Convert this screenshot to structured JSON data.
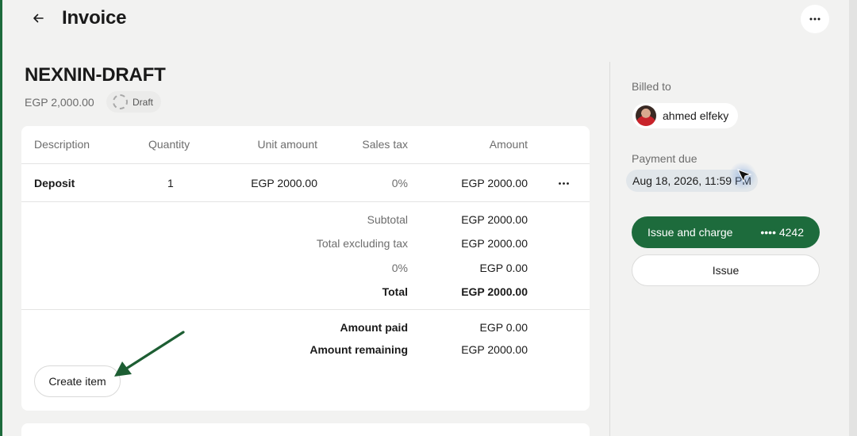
{
  "header": {
    "title": "Invoice",
    "back_icon": "arrow-left-icon",
    "more_icon": "ellipsis-icon"
  },
  "invoice": {
    "number": "NEXNIN-DRAFT",
    "amount": "EGP 2,000.00",
    "status": "Draft"
  },
  "table": {
    "columns": [
      "Description",
      "Quantity",
      "Unit amount",
      "Sales tax",
      "Amount"
    ],
    "rows": [
      {
        "description": "Deposit",
        "quantity": "1",
        "unit_amount": "EGP 2000.00",
        "sales_tax": "0%",
        "amount": "EGP 2000.00"
      }
    ]
  },
  "totals": {
    "subtotal_label": "Subtotal",
    "subtotal_value": "EGP 2000.00",
    "excl_tax_label": "Total excluding tax",
    "excl_tax_value": "EGP 2000.00",
    "tax_label": "0%",
    "tax_value": "EGP 0.00",
    "total_label": "Total",
    "total_value": "EGP 2000.00",
    "paid_label": "Amount paid",
    "paid_value": "EGP 0.00",
    "remaining_label": "Amount remaining",
    "remaining_value": "EGP 2000.00"
  },
  "actions": {
    "create_item": "Create item"
  },
  "sidebar": {
    "billed_to_label": "Billed to",
    "customer_name": "ahmed elfeky",
    "payment_due_label": "Payment due",
    "payment_due_value": "Aug 18, 2026, 11:59 PM",
    "issue_charge_label": "Issue and charge",
    "card_last4": "•••• 4242",
    "issue_label": "Issue"
  },
  "colors": {
    "brand": "#1d6b3c",
    "background": "#f2f2f1"
  }
}
